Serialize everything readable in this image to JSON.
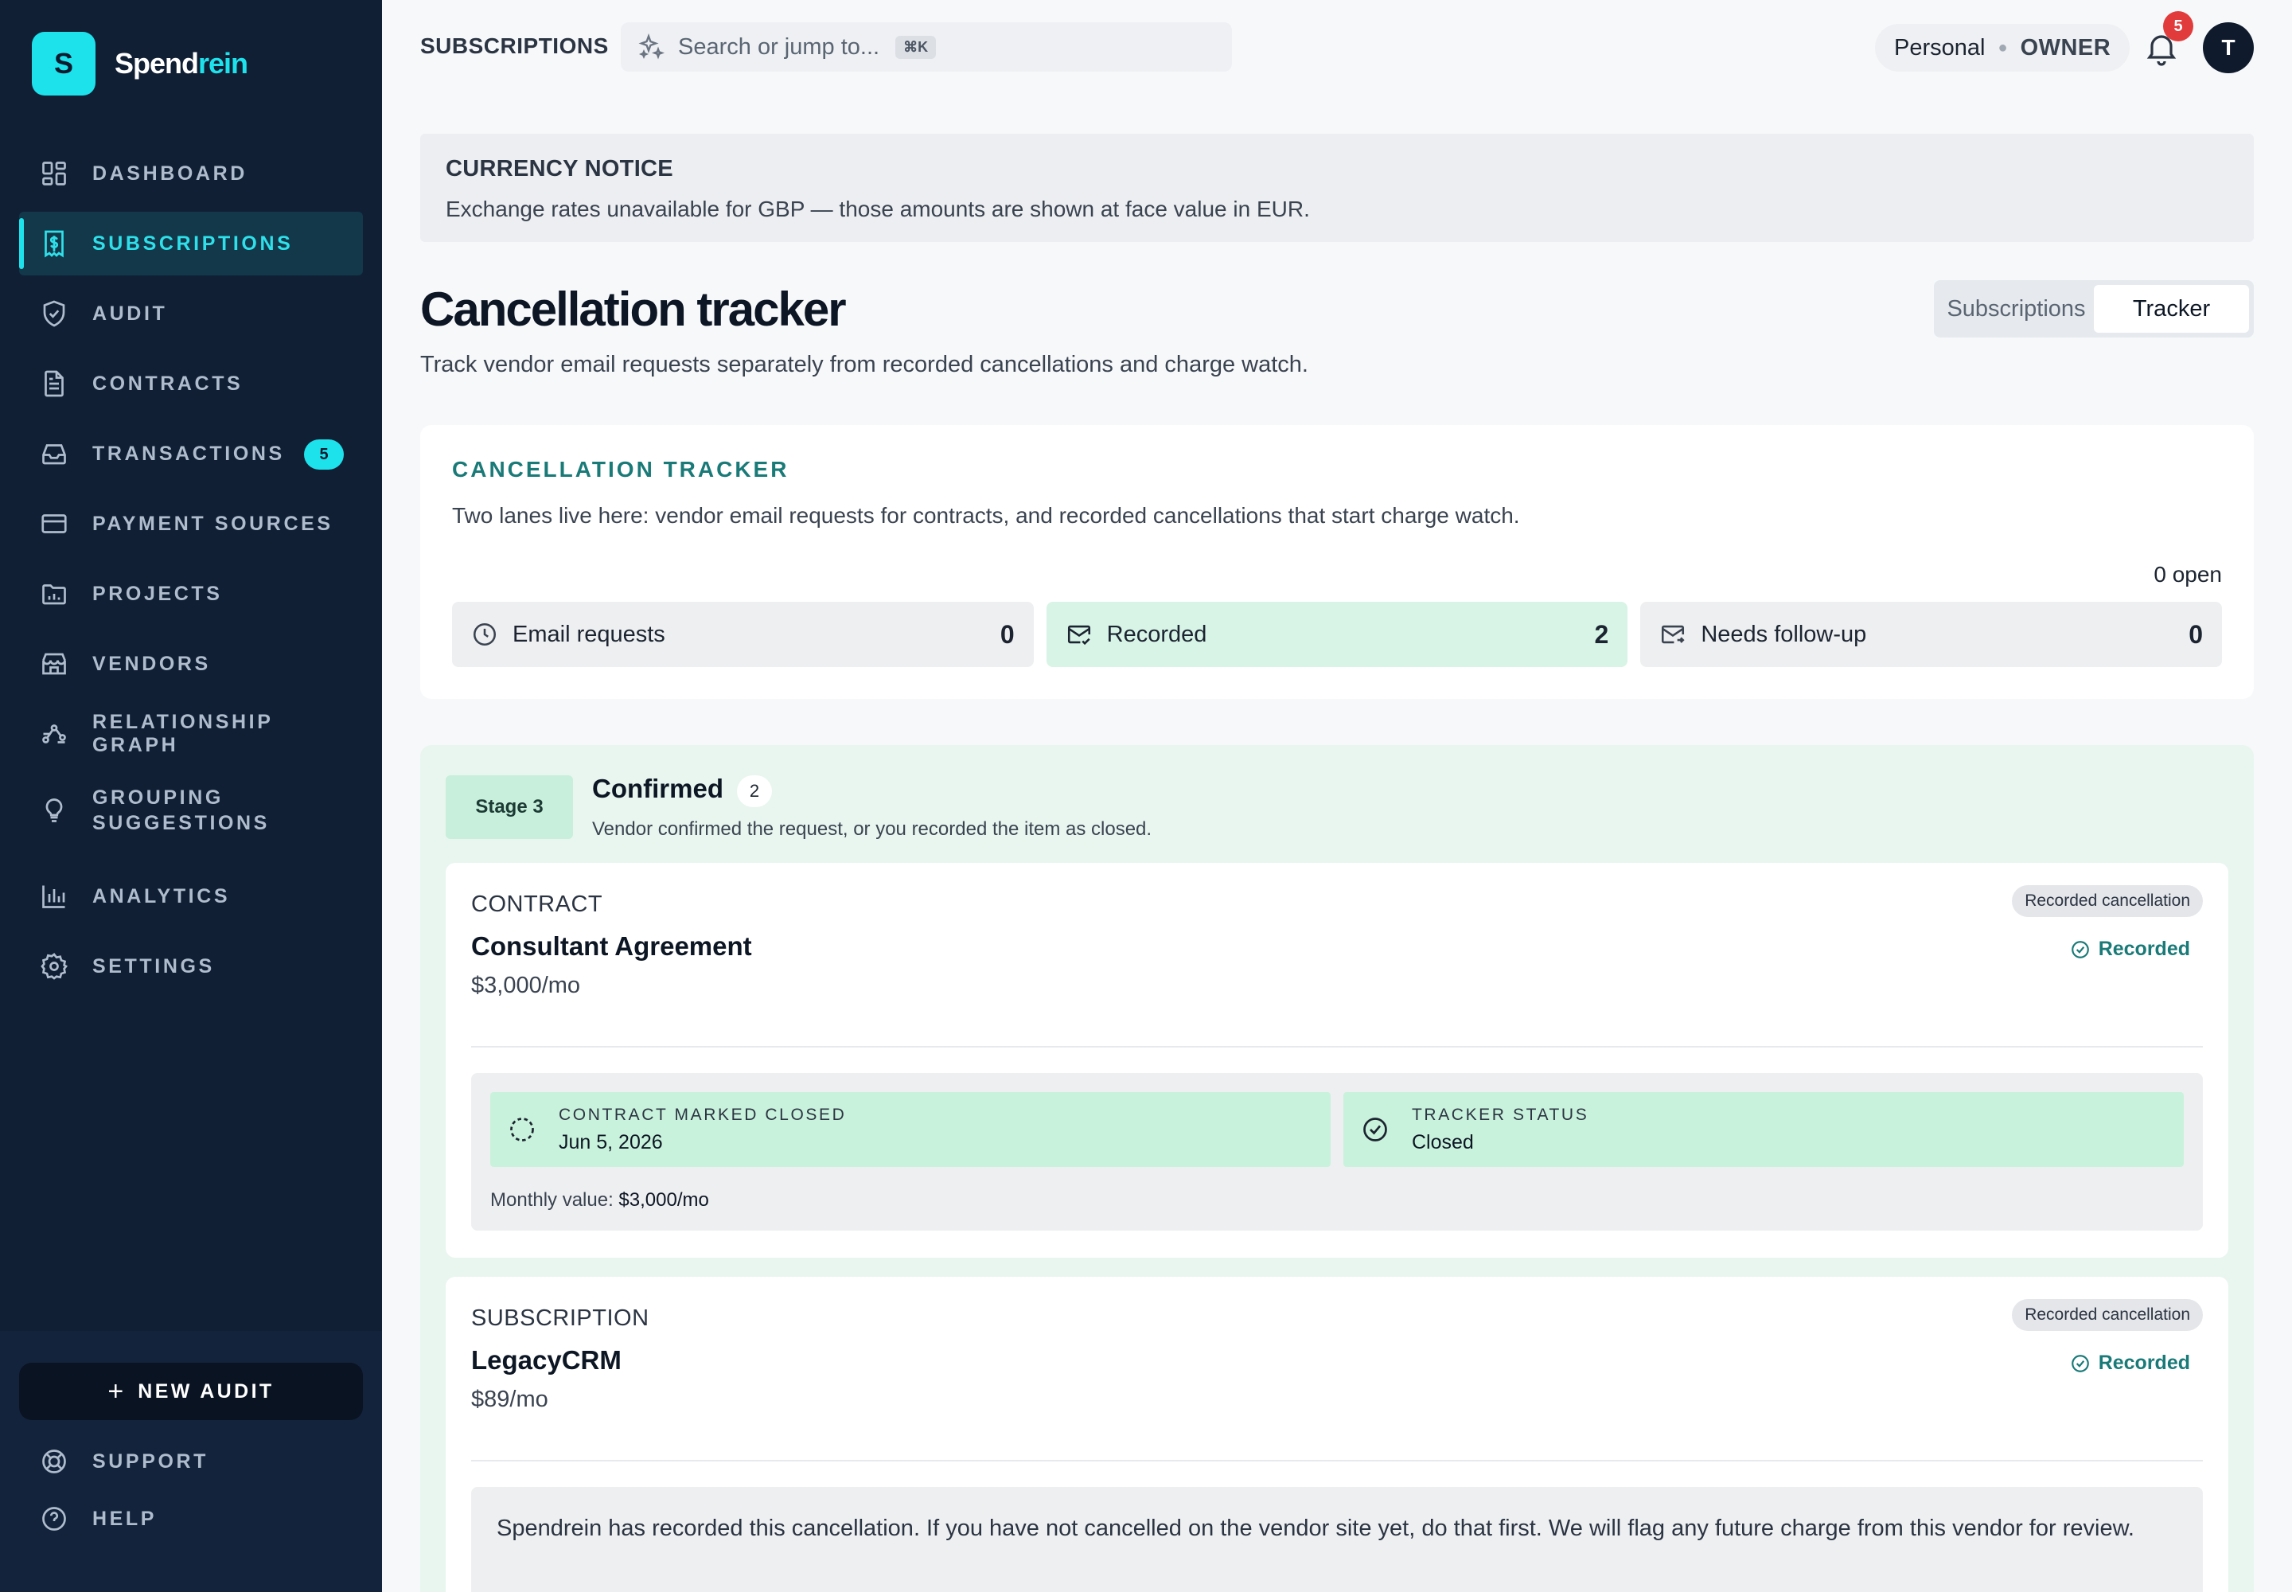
{
  "brand": {
    "logo_letter": "S",
    "name_part1": "Spend",
    "name_part2": "rein",
    "accent_color": "#1de2ec"
  },
  "sidebar": {
    "items": [
      {
        "label": "DASHBOARD",
        "icon": "grid-icon"
      },
      {
        "label": "SUBSCRIPTIONS",
        "icon": "receipt-dollar-icon",
        "active": true
      },
      {
        "label": "AUDIT",
        "icon": "shield-check-icon"
      },
      {
        "label": "CONTRACTS",
        "icon": "document-icon"
      },
      {
        "label": "TRANSACTIONS",
        "icon": "inbox-icon",
        "badge": "5"
      },
      {
        "label": "PAYMENT SOURCES",
        "icon": "credit-card-icon"
      },
      {
        "label": "PROJECTS",
        "icon": "folder-chart-icon"
      },
      {
        "label": "VENDORS",
        "icon": "store-icon"
      },
      {
        "label": "RELATIONSHIP GRAPH",
        "icon": "graph-icon"
      },
      {
        "label": "GROUPING SUGGESTIONS",
        "icon": "lightbulb-icon"
      },
      {
        "label": "ANALYTICS",
        "icon": "bar-chart-icon"
      },
      {
        "label": "SETTINGS",
        "icon": "gear-icon"
      }
    ],
    "new_audit": "NEW AUDIT",
    "support": "SUPPORT",
    "help": "HELP"
  },
  "topbar": {
    "title": "SUBSCRIPTIONS",
    "search_placeholder": "Search or jump to...",
    "shortcut": "⌘K",
    "workspace": "Personal",
    "role": "OWNER",
    "notifications": "5",
    "avatar": "T"
  },
  "notice": {
    "title": "CURRENCY NOTICE",
    "text": "Exchange rates unavailable for GBP — those amounts are shown at face value in EUR."
  },
  "page": {
    "title": "Cancellation tracker",
    "subtitle": "Track vendor email requests separately from recorded cancellations and charge watch.",
    "tabs": [
      "Subscriptions",
      "Tracker"
    ],
    "active_tab": "Tracker"
  },
  "tracker": {
    "title": "CANCELLATION TRACKER",
    "description": "Two lanes live here: vendor email requests for contracts, and recorded cancellations that start charge watch.",
    "open_count": "0 open",
    "stats": [
      {
        "label": "Email requests",
        "value": "0",
        "icon": "clock-icon"
      },
      {
        "label": "Recorded",
        "value": "2",
        "icon": "mail-check-icon"
      },
      {
        "label": "Needs follow-up",
        "value": "0",
        "icon": "mail-icon"
      }
    ]
  },
  "stage": {
    "pill": "Stage 3",
    "name": "Confirmed",
    "count": "2",
    "description": "Vendor confirmed the request, or you recorded the item as closed."
  },
  "items": [
    {
      "type": "CONTRACT",
      "name": "Consultant Agreement",
      "price": "$3,000/mo",
      "badge": "Recorded cancellation",
      "state": "Recorded",
      "details": [
        {
          "label": "CONTRACT MARKED CLOSED",
          "value": "Jun 5, 2026",
          "icon": "dashed-circle-icon"
        },
        {
          "label": "TRACKER STATUS",
          "value": "Closed",
          "icon": "check-circle-icon"
        }
      ],
      "monthly_label": "Monthly value:",
      "monthly_value": "$3,000/mo"
    },
    {
      "type": "SUBSCRIPTION",
      "name": "LegacyCRM",
      "price": "$89/mo",
      "badge": "Recorded cancellation",
      "state": "Recorded",
      "note": "Spendrein has recorded this cancellation. If you have not cancelled on the vendor site yet, do that first. We will flag any future charge from this vendor for review."
    }
  ]
}
